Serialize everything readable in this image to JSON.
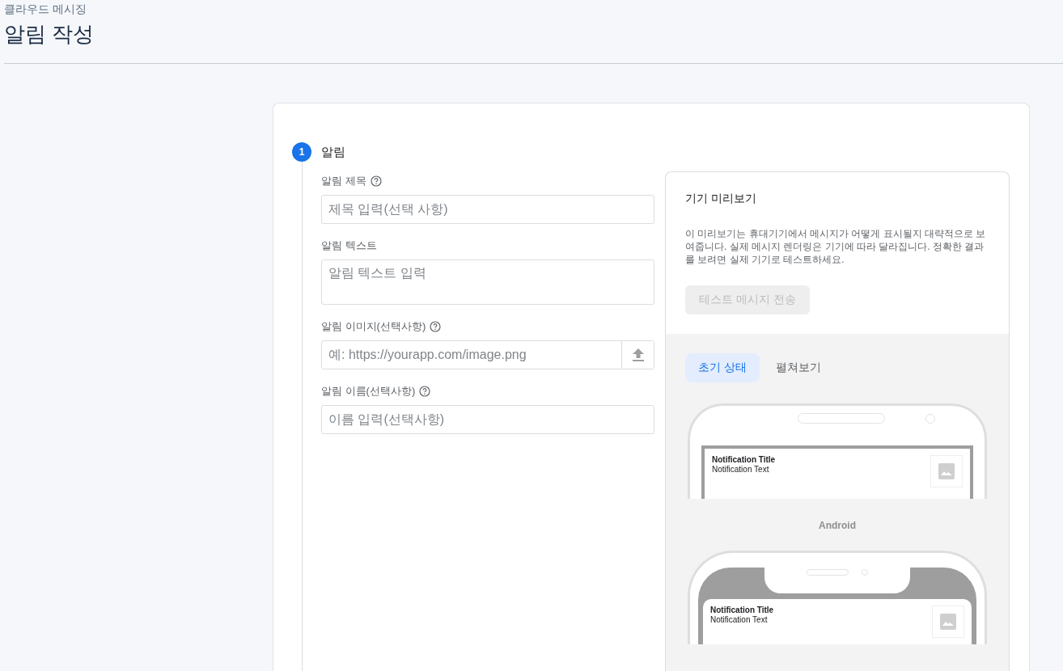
{
  "header": {
    "breadcrumb": "클라우드 메시징",
    "title": "알림 작성"
  },
  "step": {
    "number": "1",
    "title": "알림"
  },
  "fields": [
    {
      "kind": "input",
      "label": "알림 제목",
      "help": true,
      "placeholder": "제목 입력(선택 사항)"
    },
    {
      "kind": "textarea",
      "label": "알림 텍스트",
      "help": false,
      "placeholder": "알림 텍스트 입력"
    },
    {
      "kind": "upload",
      "label": "알림 이미지(선택사항)",
      "help": true,
      "placeholder": "예: https://yourapp.com/image.png"
    },
    {
      "kind": "input",
      "label": "알림 이름(선택사항)",
      "help": true,
      "placeholder": "이름 입력(선택사항)"
    }
  ],
  "preview": {
    "title": "기기 미리보기",
    "description": "이 미리보기는 휴대기기에서 메시지가 어떻게 표시될지 대략적으로 보여줍니다. 실제 메시지 렌더링은 기기에 따라 달라집니다. 정확한 결과를 보려면 실제 기기로 테스트하세요.",
    "button": {
      "label": "테스트 메시지 전송",
      "disabled": true
    },
    "tabs": [
      {
        "label": "초기 상태",
        "selected": true
      },
      {
        "label": "펼쳐보기",
        "selected": false
      }
    ],
    "devices": [
      {
        "kind": "android",
        "title": "Notification Title",
        "text": "Notification Text",
        "label": "Android"
      },
      {
        "kind": "ios",
        "title": "Notification Title",
        "text": "Notification Text"
      }
    ]
  }
}
